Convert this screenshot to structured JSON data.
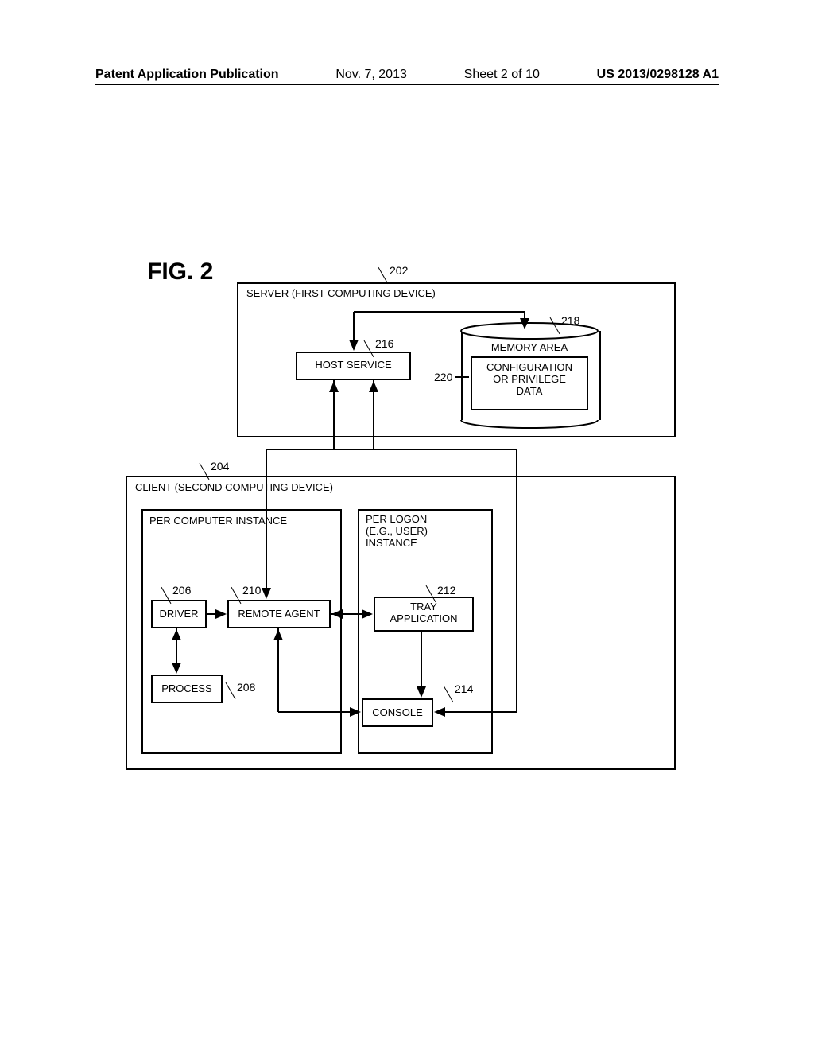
{
  "header": {
    "publication": "Patent Application Publication",
    "date": "Nov. 7, 2013",
    "sheet": "Sheet 2 of 10",
    "docnum": "US 2013/0298128 A1"
  },
  "fig": "FIG. 2",
  "refs": {
    "server": "202",
    "client": "204",
    "driver": "206",
    "process": "208",
    "remoteAgent": "210",
    "trayApp": "212",
    "console": "214",
    "hostService": "216",
    "memoryArea": "218",
    "configData": "220"
  },
  "labels": {
    "serverTitle": "SERVER (FIRST COMPUTING DEVICE)",
    "clientTitle": "CLIENT (SECOND COMPUTING DEVICE)",
    "perComputer": "PER COMPUTER INSTANCE",
    "perLogonHeader1": "PER LOGON",
    "perLogonHeader2": "(E.G., USER)",
    "perLogonHeader3": "INSTANCE",
    "hostService": "HOST SERVICE",
    "memoryArea": "MEMORY AREA",
    "configData1": "CONFIGURATION",
    "configData2": "OR PRIVILEGE",
    "configData3": "DATA",
    "driver": "DRIVER",
    "remoteAgent": "REMOTE AGENT",
    "trayApp1": "TRAY",
    "trayApp2": "APPLICATION",
    "process": "PROCESS",
    "console": "CONSOLE"
  }
}
